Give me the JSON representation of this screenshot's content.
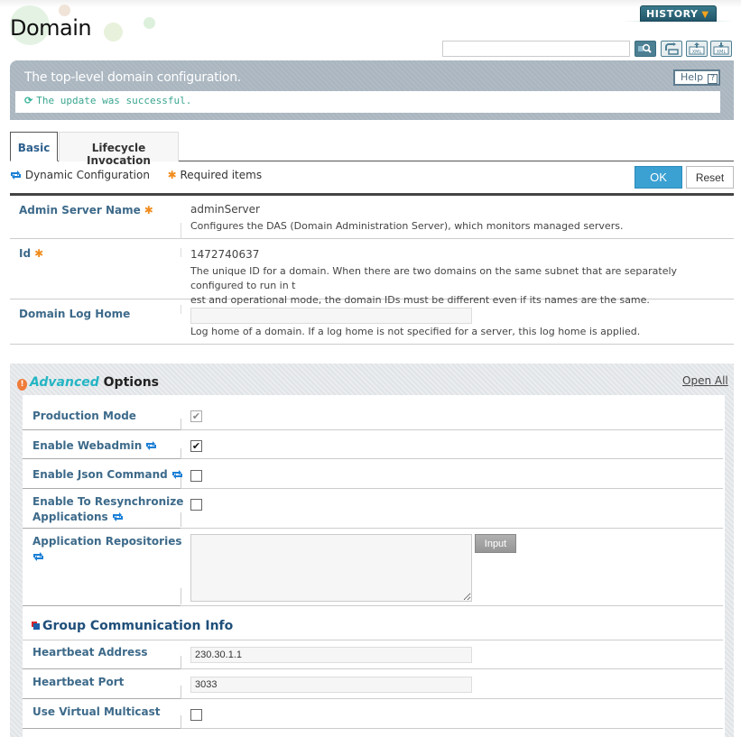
{
  "header": {
    "title": "Domain",
    "history_label": "HISTORY",
    "search": {
      "value": "",
      "placeholder": ""
    },
    "tools": [
      "search-icon",
      "reload-icon",
      "xml-upload-icon",
      "xml-download-icon"
    ]
  },
  "description": {
    "text": "The top-level domain configuration.",
    "help_label": "Help",
    "help_glyph": "?",
    "message": "The update was successful."
  },
  "tabs": [
    {
      "label": "Basic",
      "active": true
    },
    {
      "label": "Lifecycle Invocation",
      "active": false
    }
  ],
  "legend": {
    "dynamic": "Dynamic Configuration",
    "required": "Required items"
  },
  "actions": {
    "ok": "OK",
    "reset": "Reset"
  },
  "basic_fields": [
    {
      "label": "Admin Server Name",
      "required": true,
      "value": "adminServer",
      "help": "Configures the DAS (Domain Administration Server), which monitors managed servers."
    },
    {
      "label": "Id",
      "required": true,
      "value": "1472740637",
      "help_lines": [
        "The unique ID for a domain. When there are two domains on the same subnet that are separately configured to run in t",
        "est and operational mode, the domain IDs must be different even if its names are the same."
      ]
    },
    {
      "label": "Domain Log Home",
      "required": false,
      "value": "",
      "help": "Log home of a domain. If a log home is not specified for a server, this log home is applied."
    }
  ],
  "advanced": {
    "title_word": "Advanced",
    "title_rest": "Options",
    "open_all": "Open All",
    "fields": [
      {
        "label": "Production Mode",
        "checked": true,
        "disabled": true
      },
      {
        "label": "Enable Webadmin",
        "checked": true,
        "dynamic": true
      },
      {
        "label": "Enable Json Command",
        "checked": false,
        "dynamic": true
      },
      {
        "label_lines": [
          "Enable To Resynchronize",
          "Applications"
        ],
        "checked": false,
        "dynamic": true
      },
      {
        "label": "Application Repositories",
        "dynamic": true,
        "value": "",
        "button": "Input"
      }
    ],
    "group": {
      "title": "Group Communication Info",
      "fields": [
        {
          "label": "Heartbeat Address",
          "value": "230.30.1.1"
        },
        {
          "label": "Heartbeat Port",
          "value": "3033"
        },
        {
          "label": "Use Virtual Multicast",
          "checked": false
        }
      ]
    }
  },
  "check_glyph": "✔",
  "required_glyph": "✱",
  "colors": {
    "accent": "#3ba0d2",
    "label": "#3d6a8a",
    "success": "#3aa690",
    "required": "#f08c1d",
    "advanced": "#25b5c4"
  }
}
